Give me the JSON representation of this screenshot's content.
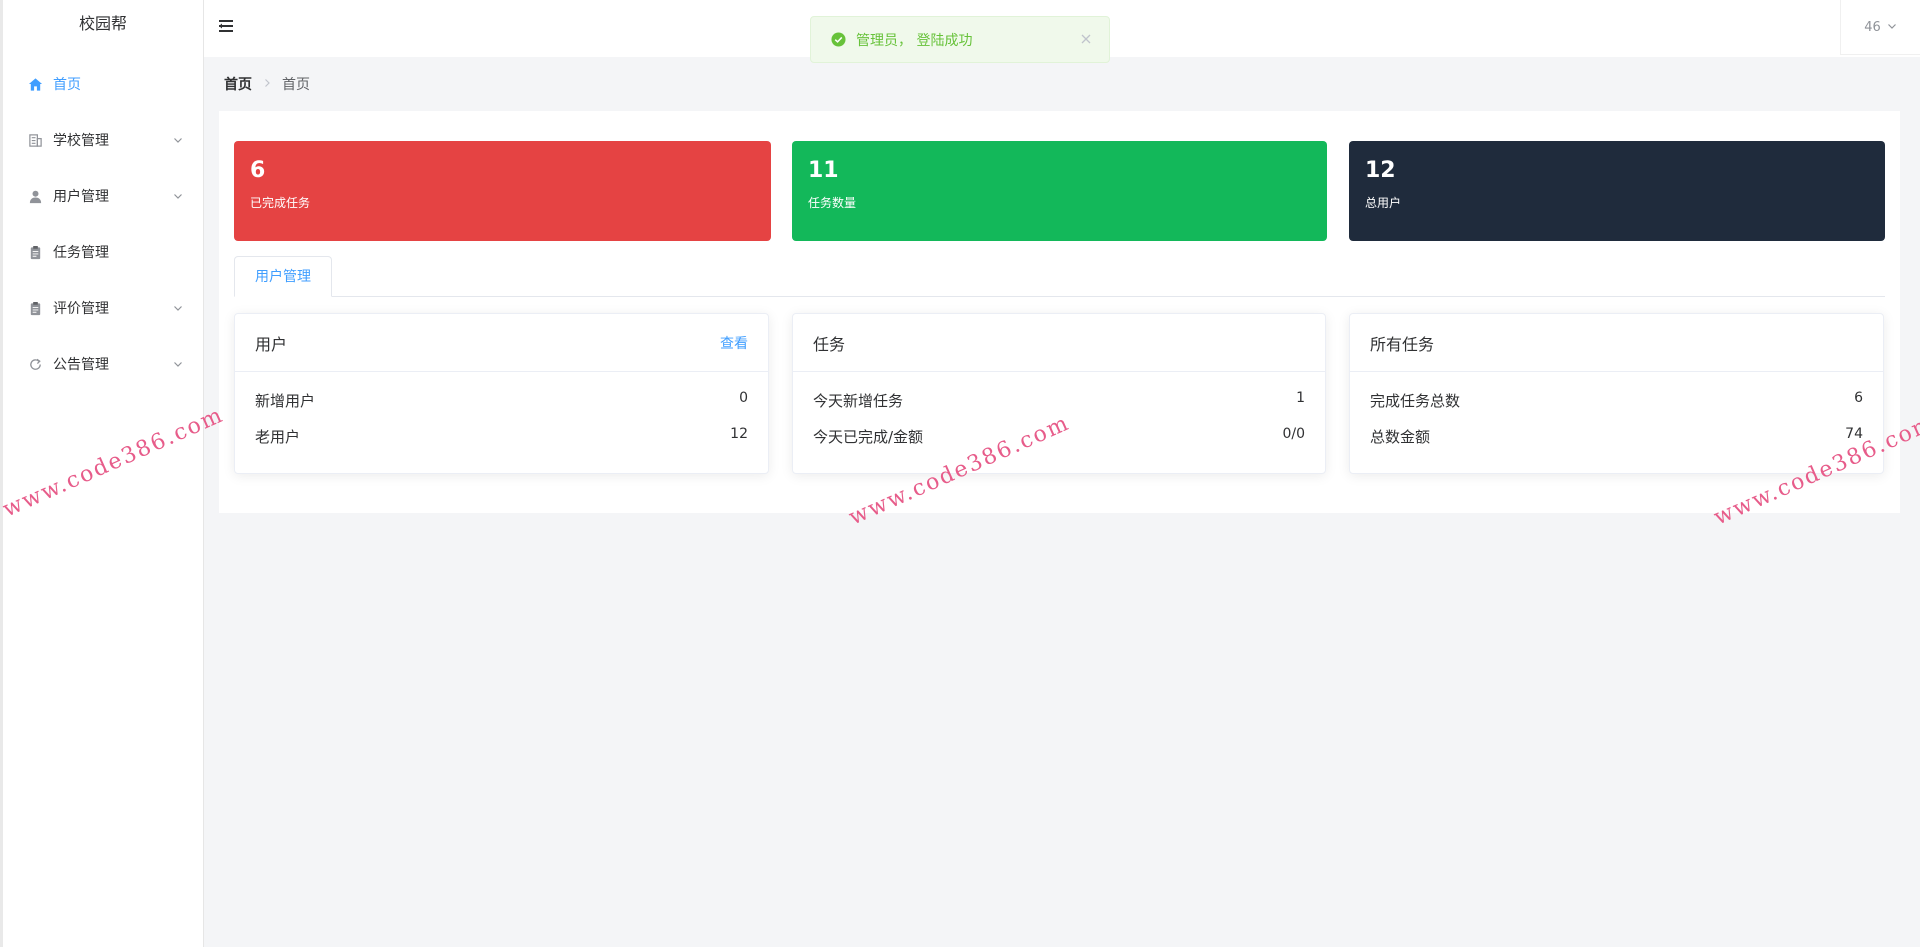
{
  "app": {
    "title": "校园帮"
  },
  "sidebar": {
    "items": [
      {
        "label": "首页",
        "icon": "home-icon"
      },
      {
        "label": "学校管理",
        "icon": "building-icon"
      },
      {
        "label": "用户管理",
        "icon": "user-icon"
      },
      {
        "label": "任务管理",
        "icon": "clipboard-icon"
      },
      {
        "label": "评价管理",
        "icon": "clipboard-icon"
      },
      {
        "label": "公告管理",
        "icon": "refresh-icon"
      }
    ]
  },
  "header": {
    "user": "46"
  },
  "toast": {
    "message": "管理员， 登陆成功",
    "color": "#67c23a"
  },
  "breadcrumb": [
    "首页",
    "首页"
  ],
  "stats": [
    {
      "value": "6",
      "label": "已完成任务",
      "color": "#e54343"
    },
    {
      "value": "11",
      "label": "任务数量",
      "color": "#13b85a"
    },
    {
      "value": "12",
      "label": "总用户",
      "color": "#1f2b3c"
    }
  ],
  "tabs": [
    {
      "label": "用户管理"
    }
  ],
  "cards": [
    {
      "title": "用户",
      "link": "查看",
      "rows": [
        {
          "label": "新增用户",
          "value": "0"
        },
        {
          "label": "老用户",
          "value": "12"
        }
      ]
    },
    {
      "title": "任务",
      "rows": [
        {
          "label": "今天新增任务",
          "value": "1"
        },
        {
          "label": "今天已完成/金额",
          "value": "0/0"
        }
      ]
    },
    {
      "title": "所有任务",
      "rows": [
        {
          "label": "完成任务总数",
          "value": "6"
        },
        {
          "label": "总数金额",
          "value": "74"
        }
      ]
    }
  ],
  "watermark": "www.code386.com",
  "accent": "#409eff"
}
